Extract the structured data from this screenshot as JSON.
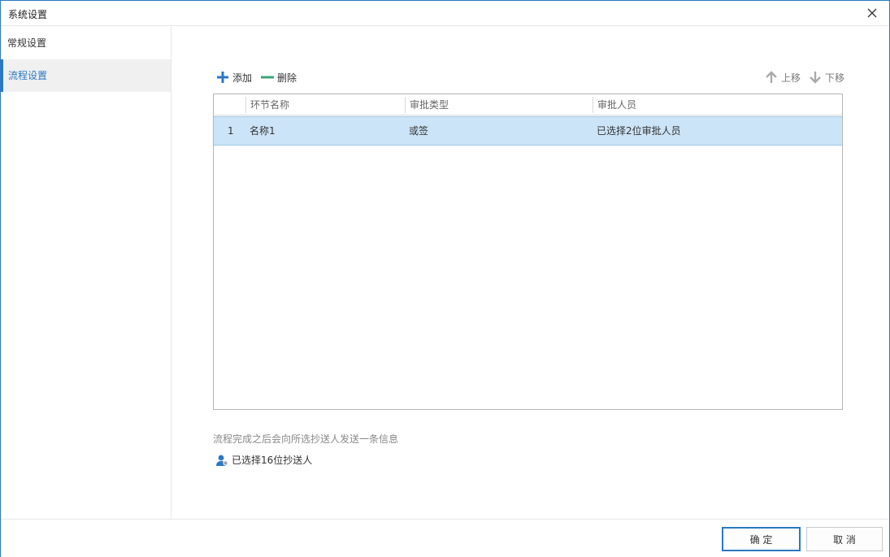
{
  "window": {
    "title": "系统设置"
  },
  "sidebar": {
    "items": [
      {
        "label": "常规设置",
        "active": false
      },
      {
        "label": "流程设置",
        "active": true
      }
    ]
  },
  "toolbar": {
    "add_label": "添加",
    "delete_label": "删除",
    "move_up_label": "上移",
    "move_down_label": "下移"
  },
  "table": {
    "columns": [
      "环节名称",
      "审批类型",
      "审批人员"
    ],
    "rows": [
      {
        "index": "1",
        "name": "名称1",
        "type": "或签",
        "approvers": "已选择2位审批人员",
        "selected": true
      }
    ]
  },
  "notice": "流程完成之后会向所选抄送人发送一条信息",
  "cc": {
    "label": "已选择16位抄送人"
  },
  "footer": {
    "ok_label": "确 定",
    "cancel_label": "取 消"
  },
  "colors": {
    "accent": "#2b79c2",
    "selected_row": "#cce4f7",
    "delete_icon": "#3aa57a",
    "add_icon": "#2b79c2"
  },
  "icons": [
    "close-icon",
    "plus-icon",
    "minus-icon",
    "arrow-up-icon",
    "arrow-down-icon",
    "user-icon"
  ]
}
